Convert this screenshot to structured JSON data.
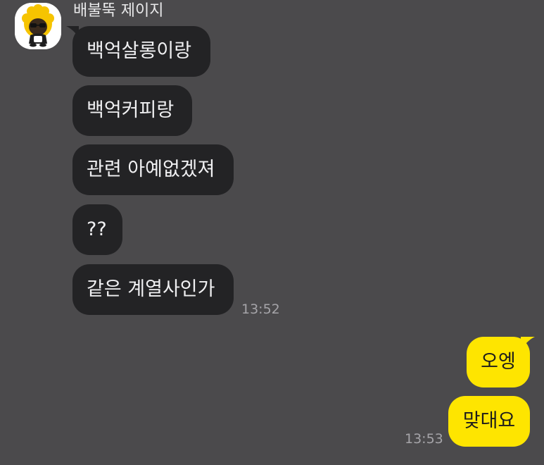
{
  "chat": {
    "sender": {
      "name": "배불뚝 제이지",
      "avatar_icon": "character-avatar-icon"
    },
    "received_messages": [
      {
        "text": "백억살롱이랑"
      },
      {
        "text": "백억커피랑"
      },
      {
        "text": "관련 아예없겠져"
      },
      {
        "text": "??"
      },
      {
        "text": "같은 계열사인가",
        "time": "13:52"
      }
    ],
    "sent_messages": [
      {
        "text": "오엥"
      },
      {
        "text": "맞대요",
        "time": "13:53"
      }
    ]
  },
  "colors": {
    "background": "#4b4a4c",
    "received_bubble": "#232325",
    "received_text": "#f0f0f2",
    "sent_bubble": "#fee500",
    "sent_text": "#1c1c1c",
    "timestamp": "#a5a4a8",
    "sender_name": "#e9e9ea"
  }
}
